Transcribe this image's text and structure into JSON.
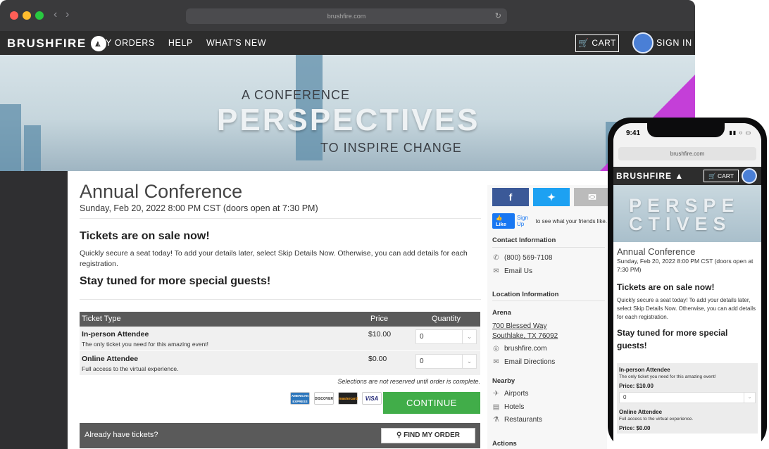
{
  "browser": {
    "url": "brushfire.com"
  },
  "site_nav": {
    "logo": "BRUSHFIRE",
    "menu": [
      "MY ORDERS",
      "HELP",
      "WHAT'S NEW"
    ],
    "cart": "CART",
    "sign_in": "SIGN IN"
  },
  "hero": {
    "line1": "A CONFERENCE",
    "title": "PERSPECTIVES",
    "line3": "TO INSPIRE CHANGE"
  },
  "event": {
    "title": "Annual Conference",
    "date": "Sunday, Feb 20, 2022 8:00 PM CST (doors open at 7:30 PM)",
    "heading": "Tickets are on sale now!",
    "description": "Quickly secure a seat today! To add your details later, select Skip Details Now. Otherwise, you can add details for each registration.",
    "subheading": "Stay tuned for more special guests!"
  },
  "ticket_table": {
    "headers": {
      "type": "Ticket Type",
      "price": "Price",
      "quantity": "Quantity"
    },
    "rows": [
      {
        "name": "In-person Attendee",
        "description": "The only ticket you need for this amazing event!",
        "price": "$10.00",
        "quantity": "0"
      },
      {
        "name": "Online Attendee",
        "description": "Full access to the virtual experience.",
        "price": "$0.00",
        "quantity": "0"
      }
    ],
    "note": "Selections are not reserved until order is complete."
  },
  "payment_cards": [
    "AMERICAN EXPRESS",
    "DISCOVER",
    "mastercard",
    "VISA"
  ],
  "continue_label": "CONTINUE",
  "already": {
    "label": "Already have tickets?",
    "button": "FIND MY ORDER"
  },
  "sidebar": {
    "like": "Like",
    "like_text_link": "Sign Up",
    "like_text": "to see what your friends like.",
    "contact_heading": "Contact Information",
    "phone": "(800) 569-7108",
    "email": "Email Us",
    "location_heading": "Location Information",
    "venue": "Arena",
    "address1": "700 Blessed Way",
    "address2": "Southlake, TX 76092",
    "website": "brushfire.com",
    "directions": "Email Directions",
    "nearby_heading": "Nearby",
    "nearby": [
      "Airports",
      "Hotels",
      "Restaurants"
    ],
    "actions_heading": "Actions"
  },
  "phone": {
    "time": "9:41",
    "url": "brushfire.com",
    "logo": "BRUSHFIRE",
    "cart": "CART",
    "hero_line1": "PERSPE",
    "hero_line2": "CTIVES",
    "title": "Annual Conference",
    "date": "Sunday, Feb 20, 2022 8:00 PM CST (doors open at 7:30 PM)",
    "heading": "Tickets are on sale now!",
    "description": "Quickly secure a seat today! To add your details later, select Skip Details Now. Otherwise, you can add details for each registration.",
    "subheading": "Stay tuned for more special guests!",
    "tickets": [
      {
        "name": "In-person Attendee",
        "description": "The only ticket you need for this amazing event!",
        "price": "Price: $10.00",
        "quantity": "0"
      },
      {
        "name": "Online Attendee",
        "description": "Full access to the virtual experience.",
        "price": "Price: $0.00"
      }
    ]
  },
  "colors": {
    "nav_bg": "#2d2d2d",
    "continue": "#41ad49",
    "facebook": "#3b5998",
    "twitter": "#1da1f2",
    "hero_accent": "#c43fd8"
  }
}
